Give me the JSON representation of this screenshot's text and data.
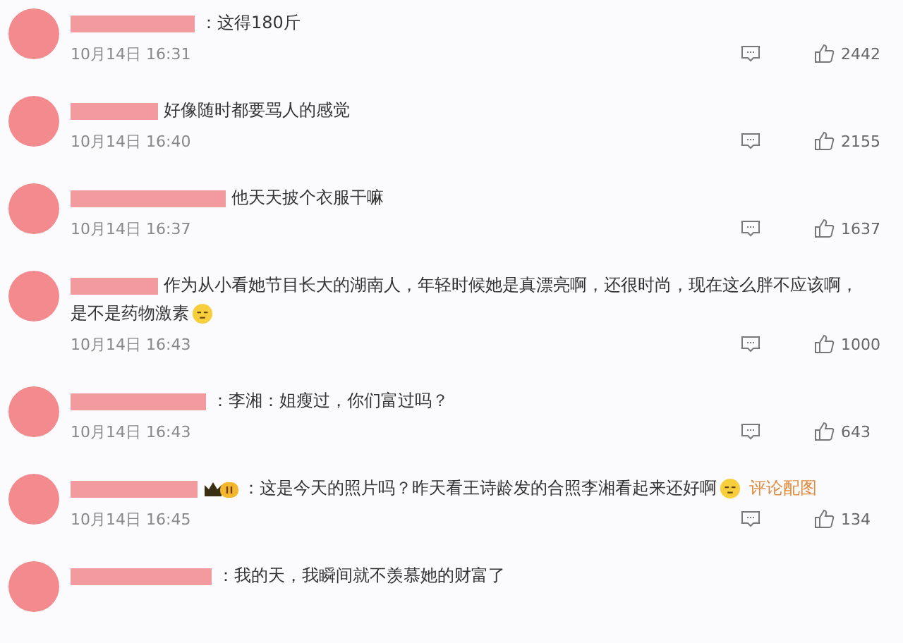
{
  "comments": [
    {
      "text": "：这得180斤",
      "time": "10月14日 16:31",
      "likes": "2442"
    },
    {
      "text": "好像随时都要骂人的感觉",
      "time": "10月14日 16:40",
      "likes": "2155"
    },
    {
      "text": "他天天披个衣服干嘛",
      "time": "10月14日 16:37",
      "likes": "1637"
    },
    {
      "text": "作为从小看她节目长大的湖南人，年轻时候她是真漂亮啊，还很时尚，现在这么胖不应该啊，",
      "text_line_2": "是不是药物激素",
      "emoji": true,
      "time": "10月14日 16:43",
      "likes": "1000"
    },
    {
      "text": "：李湘：姐瘦过，你们富过吗？",
      "time": "10月14日 16:43",
      "likes": "643"
    },
    {
      "text": "：这是今天的照片吗？昨天看王诗龄发的合照李湘看起来还好啊",
      "badge": true,
      "emoji": true,
      "link": "评论配图",
      "time": "10月14日 16:45",
      "likes": "134"
    },
    {
      "text": "：我的天，我瞬间就不羡慕她的财富了"
    }
  ]
}
